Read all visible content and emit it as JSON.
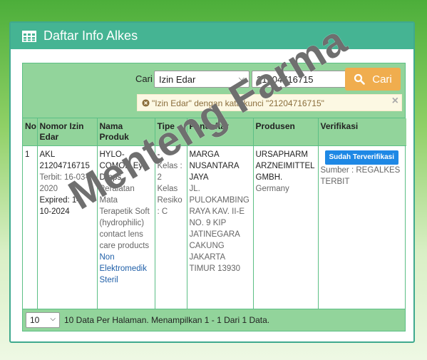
{
  "panel": {
    "title": "Daftar Info Alkes"
  },
  "search": {
    "label": "Cari",
    "select_value": "Izin Edar",
    "input_value": "21204716715",
    "button_label": "Cari",
    "alert_text": "\"Izin Edar\" dengan kata kunci \"21204716715\"",
    "alert_close": "×"
  },
  "table": {
    "headers": [
      "No",
      "Nomor Izin Edar",
      "Nama Produk",
      "Tipe",
      "Pendaftar",
      "Produsen",
      "Verifikasi"
    ],
    "rows": [
      {
        "no": "1",
        "izin": "AKL 21204716715",
        "terbit": "Terbit: 16-03-2020",
        "expired": "Expired: 14-10-2024",
        "produk": "HYLO-COMOD Eye Drops",
        "produk_desc": "Peralatan Mata Terapetik Soft (hydrophilic) contact lens care products",
        "produk_cat": "Non Elektromedik Steril",
        "tipe_dash": "-",
        "tipe_kelas": "Kelas : 2",
        "tipe_resiko": "Kelas Resiko : C",
        "pendaftar_name": "MARGA NUSANTARA JAYA",
        "pendaftar_addr": "JL. PULOKAMBING RAYA KAV. II-E NO. 9 KIP JATINEGARA CAKUNG JAKARTA TIMUR 13930",
        "produsen_name": "URSAPHARM ARZNEIMITTEL GMBH.",
        "produsen_country": "Germany",
        "verif_badge": "Sudah Terverifikasi",
        "verif_source": "Sumber : REGALKES TERBIT"
      }
    ]
  },
  "footer": {
    "page_size": "10",
    "info": "10 Data Per Halaman. Menampilkan 1 - 1 Dari 1 Data."
  },
  "watermark": "Menteng Farma",
  "icons": {
    "header": "table-grid-icon",
    "search": "search-icon",
    "alert": "times-circle-icon"
  },
  "colors": {
    "header_bg": "#45b493",
    "search_bg": "#92d49b",
    "button": "#f0ad4e",
    "badge": "#1e88e5"
  }
}
